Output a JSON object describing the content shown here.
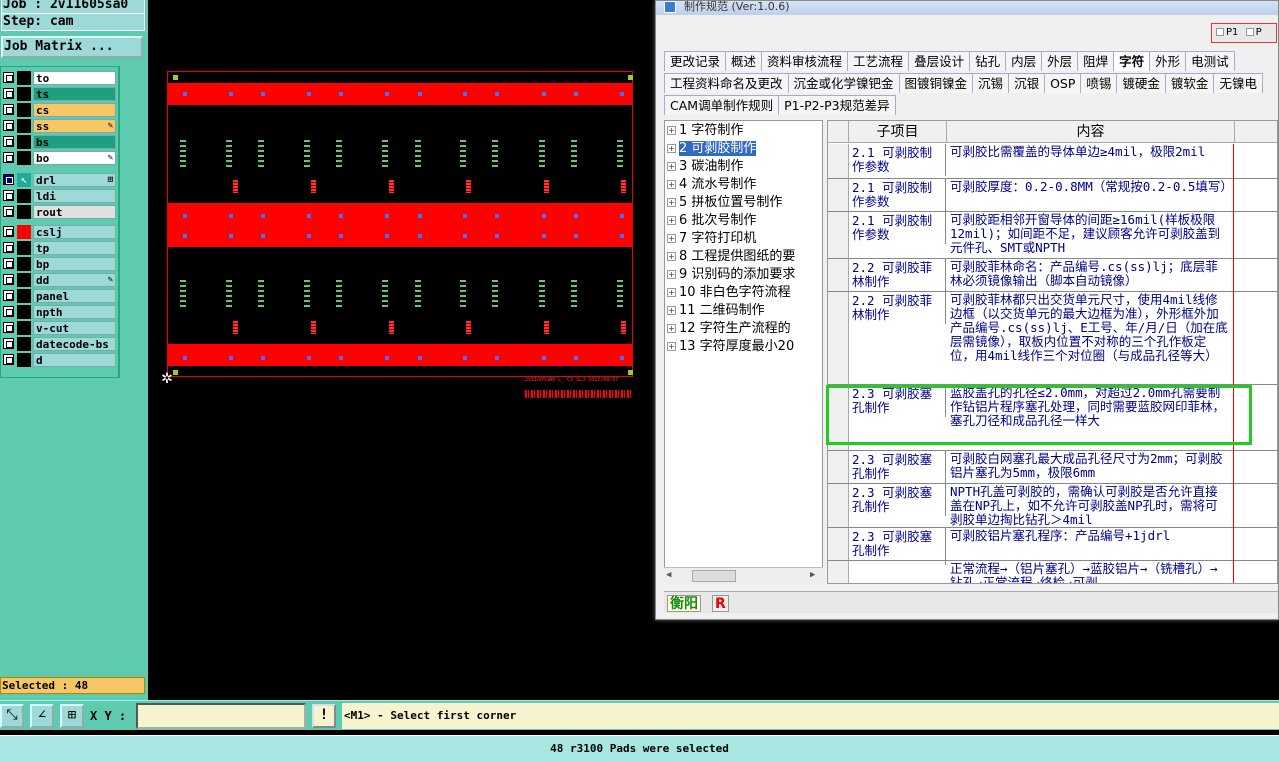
{
  "left_panel": {
    "job_label": "Job : 2v11605sa0",
    "step_label": "Step: cam",
    "job_matrix_button": "Job Matrix ...",
    "selected_text": "Selected : 48",
    "layers": [
      {
        "name": "to",
        "color": "#ffffff",
        "active": false,
        "mark": "",
        "pen": false
      },
      {
        "name": "ts",
        "color": "#1ea080",
        "active": false,
        "mark": "",
        "pen": false
      },
      {
        "name": "cs",
        "color": "#f7c766",
        "active": false,
        "mark": "",
        "pen": false
      },
      {
        "name": "ss",
        "color": "#f7c766",
        "active": false,
        "mark": "",
        "pen": true
      },
      {
        "name": "bs",
        "color": "#1ea080",
        "active": false,
        "mark": "",
        "pen": false
      },
      {
        "name": "bo",
        "color": "#ffffff",
        "active": false,
        "mark": "",
        "pen": true
      },
      {
        "name": "drl",
        "color": "#9dd9d6",
        "active": true,
        "mark": "arrow",
        "pen": false
      },
      {
        "name": "ldi",
        "color": "#9dd9d6",
        "active": false,
        "mark": "",
        "pen": false
      },
      {
        "name": "rout",
        "color": "#e0e0e0",
        "active": false,
        "mark": "",
        "pen": false
      },
      {
        "name": "cslj",
        "color": "#9dd9d6",
        "active": false,
        "mark": "red",
        "pen": false
      },
      {
        "name": "tp",
        "color": "#9dd9d6",
        "active": false,
        "mark": "",
        "pen": false
      },
      {
        "name": "bp",
        "color": "#9dd9d6",
        "active": false,
        "mark": "",
        "pen": false
      },
      {
        "name": "dd",
        "color": "#9dd9d6",
        "active": false,
        "mark": "",
        "pen": true
      },
      {
        "name": "panel",
        "color": "#9dd9d6",
        "active": false,
        "mark": "",
        "pen": false
      },
      {
        "name": "npth",
        "color": "#9dd9d6",
        "active": false,
        "mark": "",
        "pen": false
      },
      {
        "name": "v-cut",
        "color": "#9dd9d6",
        "active": false,
        "mark": "",
        "pen": false
      },
      {
        "name": "datecode-bs",
        "color": "#9dd9d6",
        "active": false,
        "mark": "",
        "pen": false
      },
      {
        "name": "d",
        "color": "#9dd9d6",
        "active": false,
        "mark": "",
        "pen": false
      }
    ]
  },
  "dialog": {
    "title": "制作规范 (Ver:1.0.6)",
    "mini_tabs": [
      "P1",
      "P"
    ],
    "tab_rows": [
      [
        "更改记录",
        "概述",
        "资料审核流程",
        "工艺流程",
        "叠层设计",
        "钻孔",
        "内层",
        "外层",
        "阻焊",
        "字符",
        "外形",
        "电测试"
      ],
      [
        "工程资料命名及更改",
        "沉金或化学镍钯金",
        "图镀铜镍金",
        "沉锡",
        "沉银",
        "OSP",
        "喷锡",
        "镀硬金",
        "镀软金",
        "无镍电"
      ],
      [
        "CAM调单制作规则",
        "P1-P2-P3规范差异"
      ]
    ],
    "selected_tab": "字符",
    "tree_items": [
      "1  字符制作",
      "2  可剥胶制作",
      "3  碳油制作",
      "4  流水号制作",
      "5  拼板位置号制作",
      "6  批次号制作",
      "7  字符打印机",
      "8  工程提供图纸的要",
      "9  识别码的添加要求",
      "10  非白色字符流程",
      "11  二维码制作",
      "12  字符生产流程的",
      "13  字符厚度最小20"
    ],
    "selected_tree_index": 1,
    "grid_headers": [
      "子项目",
      "内容"
    ],
    "grid_rows": [
      {
        "sub": "2.1 可剥胶制作参数",
        "content": "可剥胶比需覆盖的导体单边≥4mil，极限2mil"
      },
      {
        "sub": "2.1 可剥胶制作参数",
        "content": "可剥胶厚度：0.2-0.8MM（常规按0.2-0.5填写）"
      },
      {
        "sub": "2.1 可剥胶制作参数",
        "content": "可剥胶距相邻开窗导体的间距≥16mil(样板极限12mil)；如间距不足，建议顾客允许可剥胶盖到元件孔、SMT或NPTH"
      },
      {
        "sub": "2.2 可剥胶菲林制作",
        "content": "可剥胶菲林命名：产品编号.cs(ss)lj；底层菲林必须镜像输出（脚本自动镜像）"
      },
      {
        "sub": "2.2 可剥胶菲林制作",
        "content": "可剥胶菲林都只出交货单元尺寸，使用4mil线修边框（以交货单元的最大边框为准），外形框外加产品编号.cs(ss)lj、E工号、年/月/日（加在底层需镜像），取板内位置不对称的三个孔作板定位，用4mil线作三个对位圈（与成品孔径等大）"
      },
      {
        "sub": "2.3 可剥胶塞孔制作",
        "content": "蓝胶盖孔的孔径≤2.0mm，对超过2.0mm孔需要制作钻铝片程序塞孔处理，同时需要蓝胶网印菲林，塞孔刀径和成品孔径一样大"
      },
      {
        "sub": "2.3 可剥胶塞孔制作",
        "content": "可剥胶白网塞孔最大成品孔径尺寸为2mm；可剥胶铝片塞孔为5mm，极限6mm"
      },
      {
        "sub": "2.3 可剥胶塞孔制作",
        "content": "NPTH孔盖可剥胶的，需确认可剥胶是否允许直接盖在NP孔上，如不允许可剥胶盖NP孔时，需将可剥胶单边掏比钻孔＞4mil"
      },
      {
        "sub": "2.3 可剥胶塞孔制作",
        "content": "可剥胶铝片塞孔程序：产品编号+1jdrl"
      },
      {
        "sub": "",
        "content": "正常流程→（铝片塞孔）→蓝胶铝片→（铣槽孔）→钻孔→正常流程→终检→可剥"
      }
    ],
    "footer_buttons": [
      "衡阳",
      "R"
    ]
  },
  "bottom": {
    "xy_label": "X Y :",
    "xy_value": "",
    "warn_button": "!",
    "prompt": "<M1> - Select first corner",
    "status": "48 r3100 Pads were selected"
  },
  "board": {
    "footer_text": "2V11605SA0 L_ CS_SLJ 2017/08/07",
    "pad_count_selected": 48
  },
  "colors": {
    "panel_bg": "#5ecab0",
    "copper_red": "#ff0000",
    "highlight_green": "#22cc22",
    "prompt_bg": "#f8f3cf"
  }
}
